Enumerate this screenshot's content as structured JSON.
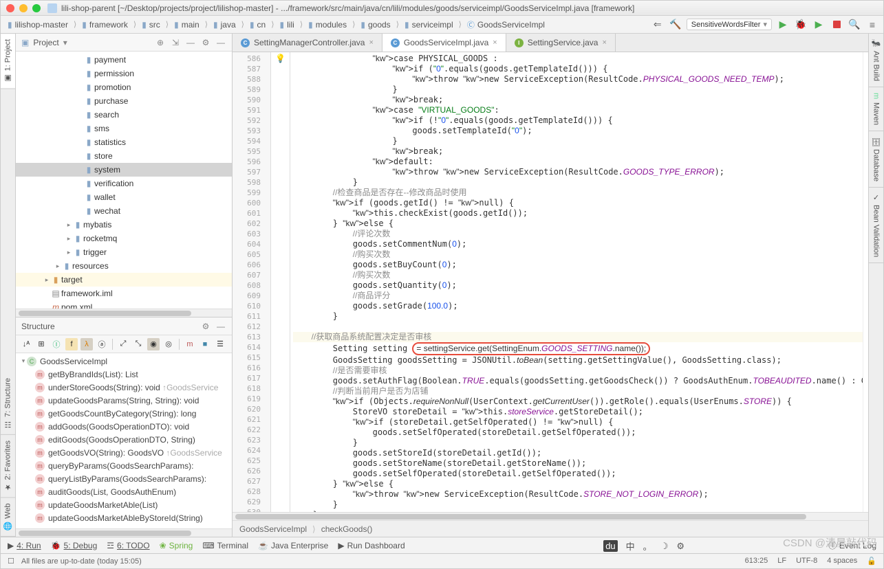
{
  "window_title": "lili-shop-parent [~/Desktop/projects/project/lilishop-master] - .../framework/src/main/java/cn/lili/modules/goods/serviceimpl/GoodsServiceImpl.java [framework]",
  "breadcrumbs": [
    "lilishop-master",
    "framework",
    "src",
    "main",
    "java",
    "cn",
    "lili",
    "modules",
    "goods",
    "serviceimpl",
    "GoodsServiceImpl"
  ],
  "run_config": "SensitiveWordsFilter",
  "left_gutter": {
    "project": "1: Project",
    "structure": "7: Structure",
    "favorites": "2: Favorites",
    "web": "Web"
  },
  "right_gutter": {
    "ant": "Ant Build",
    "maven": "Maven",
    "database": "Database",
    "bean": "Bean Validation"
  },
  "project_pane": {
    "title": "Project",
    "tree": [
      {
        "indent": 5,
        "icon": "folder",
        "label": "payment"
      },
      {
        "indent": 5,
        "icon": "folder",
        "label": "permission"
      },
      {
        "indent": 5,
        "icon": "folder",
        "label": "promotion"
      },
      {
        "indent": 5,
        "icon": "folder",
        "label": "purchase"
      },
      {
        "indent": 5,
        "icon": "folder",
        "label": "search"
      },
      {
        "indent": 5,
        "icon": "folder",
        "label": "sms"
      },
      {
        "indent": 5,
        "icon": "folder",
        "label": "statistics"
      },
      {
        "indent": 5,
        "icon": "folder",
        "label": "store"
      },
      {
        "indent": 5,
        "icon": "folder",
        "label": "system",
        "sel": true
      },
      {
        "indent": 5,
        "icon": "folder",
        "label": "verification"
      },
      {
        "indent": 5,
        "icon": "folder",
        "label": "wallet"
      },
      {
        "indent": 5,
        "icon": "folder",
        "label": "wechat"
      },
      {
        "indent": 4,
        "chev": "▸",
        "icon": "folder",
        "label": "mybatis"
      },
      {
        "indent": 4,
        "chev": "▸",
        "icon": "folder",
        "label": "rocketmq"
      },
      {
        "indent": 4,
        "chev": "▸",
        "icon": "folder",
        "label": "trigger"
      },
      {
        "indent": 3,
        "chev": "▸",
        "icon": "folder",
        "label": "resources"
      },
      {
        "indent": 2,
        "chev": "▸",
        "icon": "folder-o",
        "label": "target",
        "hl": true
      },
      {
        "indent": 2,
        "icon": "file",
        "label": "framework.iml"
      },
      {
        "indent": 2,
        "icon": "maven",
        "label": "pom.xml"
      }
    ]
  },
  "structure": {
    "title": "Structure",
    "class": "GoodsServiceImpl",
    "methods": [
      "getByBrandIds(List<String>): List<Goods>",
      "underStoreGoods(String): void ↑GoodsService",
      "updateGoodsParams(String, String): void",
      "getGoodsCountByCategory(String): long",
      "addGoods(GoodsOperationDTO): void",
      "editGoods(GoodsOperationDTO, String)",
      "getGoodsVO(String): GoodsVO ↑GoodsService",
      "queryByParams(GoodsSearchParams):",
      "queryListByParams(GoodsSearchParams):",
      "auditGoods(List<String>, GoodsAuthEnum)",
      "updateGoodsMarketAble(List<String>)",
      "updateGoodsMarketAbleByStoreId(String)"
    ]
  },
  "tabs": [
    {
      "label": "SettingManagerController.java",
      "kind": "c",
      "active": false
    },
    {
      "label": "GoodsServiceImpl.java",
      "kind": "c",
      "active": true
    },
    {
      "label": "SettingService.java",
      "kind": "i",
      "active": false
    }
  ],
  "line_start": 586,
  "line_end": 632,
  "bulb_line": 613,
  "code_lines": [
    "                case PHYSICAL_GOODS :",
    "                    if (\"0\".equals(goods.getTemplateId())) {",
    "                        throw new ServiceException(ResultCode.PHYSICAL_GOODS_NEED_TEMP);",
    "                    }",
    "                    break;",
    "                case \"VIRTUAL_GOODS\":",
    "                    if (!\"0\".equals(goods.getTemplateId())) {",
    "                        goods.setTemplateId(\"0\");",
    "                    }",
    "                    break;",
    "                default:",
    "                    throw new ServiceException(ResultCode.GOODS_TYPE_ERROR);",
    "            }",
    "        //检查商品是否存在--修改商品时使用",
    "        if (goods.getId() != null) {",
    "            this.checkExist(goods.getId());",
    "        } else {",
    "            //评论次数",
    "            goods.setCommentNum(0);",
    "            //购买次数",
    "            goods.setBuyCount(0);",
    "            //购买次数",
    "            goods.setQuantity(0);",
    "            //商品评分",
    "            goods.setGrade(100.0);",
    "        }",
    "",
    "        //获取商品系统配置决定是否审核",
    "        Setting setting = settingService.get(SettingEnum.GOODS_SETTING.name());",
    "        GoodsSetting goodsSetting = JSONUtil.toBean(setting.getSettingValue(), GoodsSetting.class);",
    "        //是否需要审核",
    "        goods.setAuthFlag(Boolean.TRUE.equals(goodsSetting.getGoodsCheck()) ? GoodsAuthEnum.TOBEAUDITED.name() : GoodsAuthEnum",
    "        //判断当前用户是否为店铺",
    "        if (Objects.requireNonNull(UserContext.getCurrentUser()).getRole().equals(UserEnums.STORE)) {",
    "            StoreVO storeDetail = this.storeService.getStoreDetail();",
    "            if (storeDetail.getSelfOperated() != null) {",
    "                goods.setSelfOperated(storeDetail.getSelfOperated());",
    "            }",
    "            goods.setStoreId(storeDetail.getId());",
    "            goods.setStoreName(storeDetail.getStoreName());",
    "            goods.setSelfOperated(storeDetail.getSelfOperated());",
    "        } else {",
    "            throw new ServiceException(ResultCode.STORE_NOT_LOGIN_ERROR);",
    "        }",
    "    }",
    "",
    ""
  ],
  "editor_breadcrumb": [
    "GoodsServiceImpl",
    "checkGoods()"
  ],
  "bottom_tools": {
    "run": "4: Run",
    "debug": "5: Debug",
    "todo": "6: TODO",
    "spring": "Spring",
    "terminal": "Terminal",
    "javaee": "Java Enterprise",
    "dashboard": "Run Dashboard",
    "eventlog": "Event Log"
  },
  "status": {
    "left": "All files are up-to-date (today 15:05)",
    "pos": "613:25",
    "lf": "LF",
    "enc": "UTF-8",
    "indent": "4 spaces"
  },
  "watermark": "CSDN @清晨敲代码",
  "ime": {
    "label": "中",
    "punct": "。",
    "moon": "☽",
    "gear": "⚙"
  }
}
